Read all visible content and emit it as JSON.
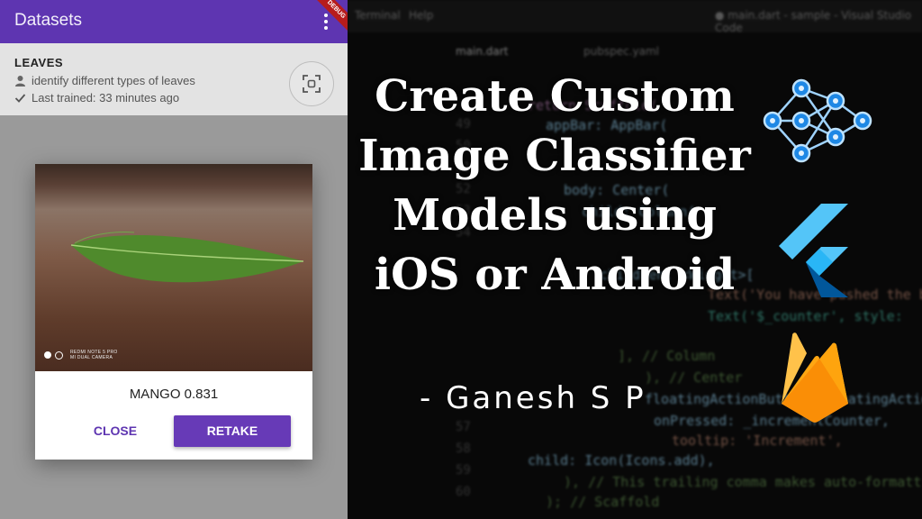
{
  "app": {
    "title": "Datasets",
    "debug_banner": "DEBUG"
  },
  "dataset": {
    "name": "LEAVES",
    "description": "identify different types of leaves",
    "last_trained": "Last trained: 33 minutes ago"
  },
  "dialog": {
    "photo_watermark_line1": "REDMI NOTE 5 PRO",
    "photo_watermark_line2": "MI DUAL CAMERA",
    "result": "MANGO 0.831",
    "close_label": "CLOSE",
    "retake_label": "RETAKE"
  },
  "thumbnail": {
    "headline_lines": [
      "Create Custom",
      "Image Classifier",
      "Models using",
      "iOS or Android"
    ],
    "author": "- Ganesh S P",
    "editor_menu": [
      "Terminal",
      "Help"
    ],
    "editor_window_title": "● main.dart - sample - Visual Studio Code",
    "editor_tabs": [
      "main.dart",
      "pubspec.yaml"
    ]
  },
  "colors": {
    "app_bar": "#5e35b1",
    "accent": "#673ab7",
    "firebase": "#ffa000",
    "flutter": "#42a5f5"
  },
  "icons": [
    "more-vert-icon",
    "person-icon",
    "check-icon",
    "scan-icon",
    "neural-network-icon",
    "flutter-logo-icon",
    "firebase-logo-icon"
  ]
}
